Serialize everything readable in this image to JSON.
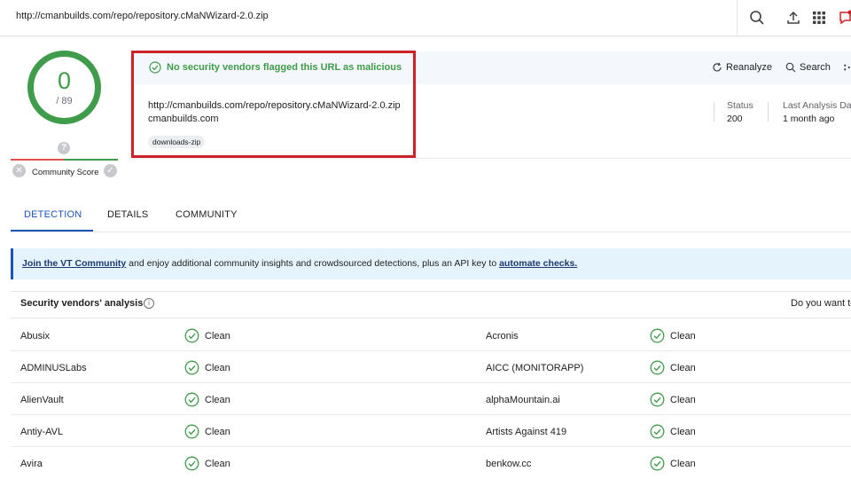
{
  "search": {
    "value": "http://cmanbuilds.com/repo/repository.cMaNWizard-2.0.zip"
  },
  "topbar_icons": [
    "search-icon",
    "upload-icon",
    "apps-grid-icon",
    "notifications-icon"
  ],
  "score": {
    "value": "0",
    "total": "/ 89",
    "community_label": "Community Score",
    "community_question": "?"
  },
  "banner": {
    "text": "No security vendors flagged this URL as malicious"
  },
  "url_info": {
    "full_url": "http://cmanbuilds.com/repo/repository.cMaNWizard-2.0.zip",
    "domain": "cmanbuilds.com",
    "tag": "downloads-zip"
  },
  "actions": {
    "reanalyze": "Reanalyze",
    "search": "Search"
  },
  "meta": {
    "status_label": "Status",
    "status_value": "200",
    "last_analysis_label": "Last Analysis Da",
    "last_analysis_value": "1 month ago"
  },
  "tabs": [
    {
      "label": "DETECTION"
    },
    {
      "label": "DETAILS"
    },
    {
      "label": "COMMUNITY"
    }
  ],
  "notice": {
    "link1": "Join the VT Community",
    "middle": " and enjoy additional community insights and crowdsourced detections, plus an API key to ",
    "link2": "automate checks."
  },
  "vendors": {
    "title": "Security vendors' analysis",
    "right_text": "Do you want to",
    "rows": [
      {
        "left_name": "Abusix",
        "left_status": "Clean",
        "right_name": "Acronis",
        "right_status": "Clean"
      },
      {
        "left_name": "ADMINUSLabs",
        "left_status": "Clean",
        "right_name": "AICC (MONITORAPP)",
        "right_status": "Clean"
      },
      {
        "left_name": "AlienVault",
        "left_status": "Clean",
        "right_name": "alphaMountain.ai",
        "right_status": "Clean"
      },
      {
        "left_name": "Antiy-AVL",
        "left_status": "Clean",
        "right_name": "Artists Against 419",
        "right_status": "Clean"
      },
      {
        "left_name": "Avira",
        "left_status": "Clean",
        "right_name": "benkow.cc",
        "right_status": "Clean"
      }
    ]
  },
  "colors": {
    "clean_green": "#3f9c4a",
    "accent_blue": "#1b55b6",
    "highlight_red": "#cc2229"
  }
}
